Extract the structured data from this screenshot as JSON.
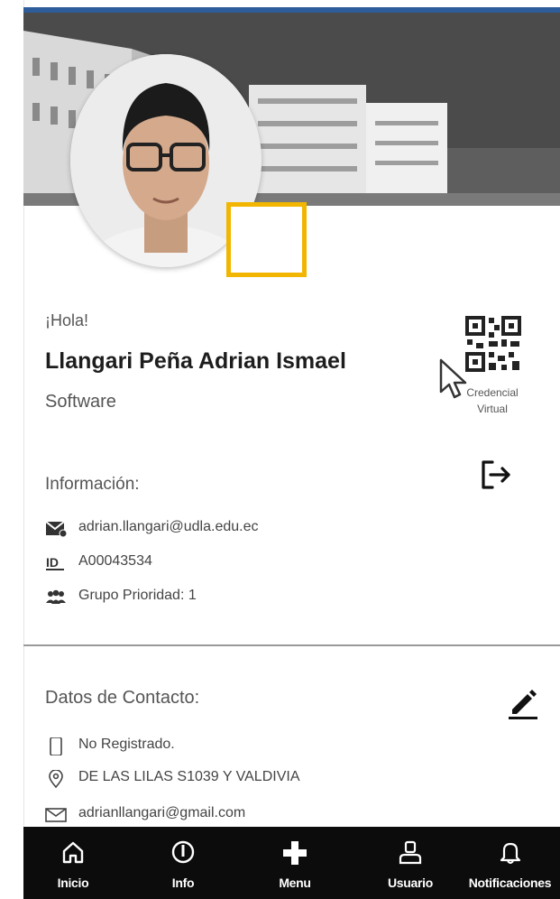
{
  "profile": {
    "greeting": "¡Hola!",
    "full_name": "Llangari Peña Adrian Ismael",
    "career": "Software"
  },
  "credential": {
    "label_line1": "Credencial",
    "label_line2": "Virtual",
    "icon": "qr-code-icon"
  },
  "info": {
    "heading": "Información:",
    "email": "adrian.llangari@udla.edu.ec",
    "id": "A00043534",
    "group": "Grupo Prioridad:  1"
  },
  "contact": {
    "heading": "Datos de Contacto:",
    "phone": "No Registrado.",
    "address": "DE LAS LILAS S1039 Y VALDIVIA",
    "email": "adrianllangari@gmail.com"
  },
  "nav": {
    "items": [
      {
        "label": "Inicio",
        "icon": "home-icon"
      },
      {
        "label": "Info",
        "icon": "info-icon"
      },
      {
        "label": "Menu",
        "icon": "plus-icon"
      },
      {
        "label": "Usuario",
        "icon": "user-icon"
      },
      {
        "label": "Notificaciones",
        "icon": "bell-icon"
      }
    ]
  },
  "colors": {
    "highlight": "#f2b600",
    "nav_bg": "#0c0c0c",
    "top_strip": "#2d5d9a"
  }
}
